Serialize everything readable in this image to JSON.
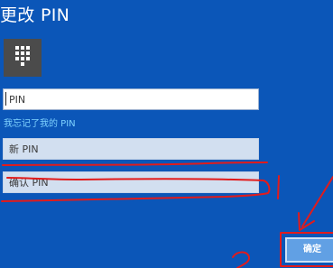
{
  "dialog": {
    "title": "更改 PIN",
    "current_pin_placeholder": "PIN",
    "forgot_pin_link": "我忘记了我的 PIN",
    "new_pin_placeholder": "新 PIN",
    "confirm_pin_placeholder": "确认 PIN",
    "ok_button_label": "确定"
  },
  "icons": {
    "keypad": "keypad-icon"
  },
  "colors": {
    "background": "#0b56b8",
    "link": "#7fd2ff",
    "annotation": "#e21b1b",
    "button": "#61a0e4"
  }
}
